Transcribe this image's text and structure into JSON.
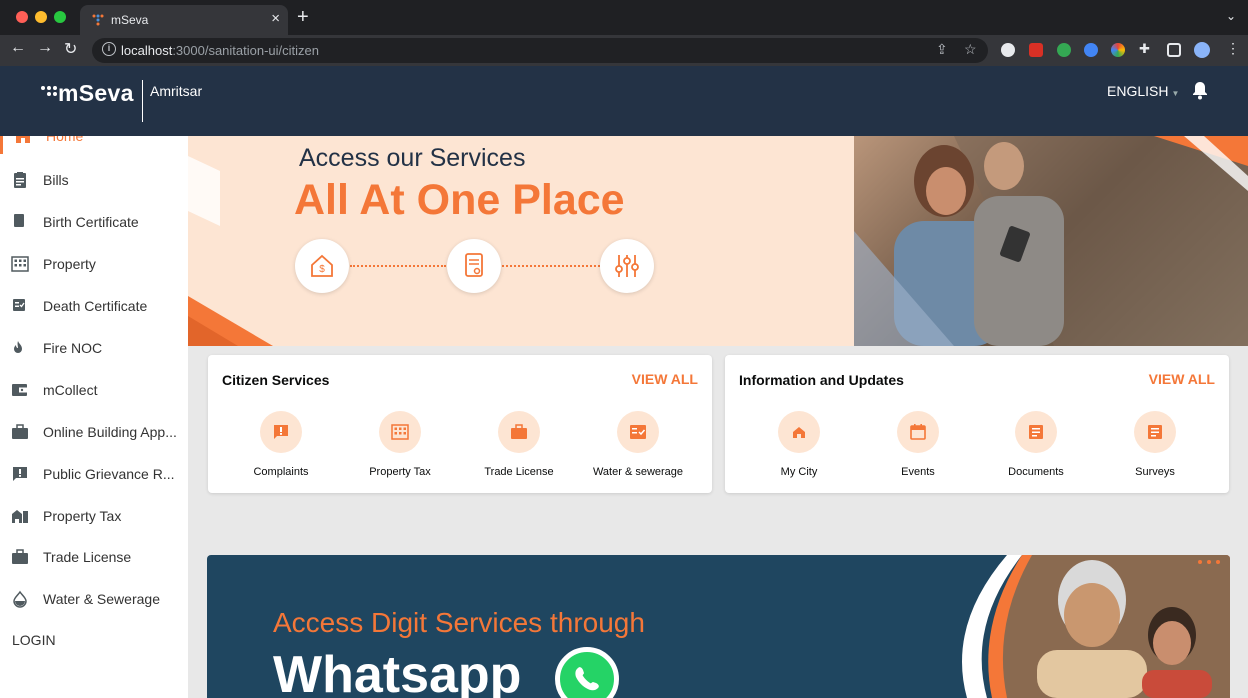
{
  "browser": {
    "tab_title": "mSeva",
    "url_host": "localhost",
    "url_path": ":3000/sanitation-ui/citizen"
  },
  "header": {
    "logo": "mSeva",
    "city": "Amritsar",
    "language": "ENGLISH"
  },
  "sidebar": {
    "items": [
      {
        "label": "Home",
        "icon": "home-icon"
      },
      {
        "label": "Bills",
        "icon": "bill-icon"
      },
      {
        "label": "Birth Certificate",
        "icon": "book-icon"
      },
      {
        "label": "Property",
        "icon": "building-icon"
      },
      {
        "label": "Death Certificate",
        "icon": "certificate-icon"
      },
      {
        "label": "Fire NOC",
        "icon": "fire-icon"
      },
      {
        "label": "mCollect",
        "icon": "wallet-icon"
      },
      {
        "label": "Online Building App...",
        "icon": "briefcase-icon"
      },
      {
        "label": "Public Grievance R...",
        "icon": "grievance-icon"
      },
      {
        "label": "Property Tax",
        "icon": "property-tax-icon"
      },
      {
        "label": "Trade License",
        "icon": "briefcase-icon"
      },
      {
        "label": "Water & Sewerage",
        "icon": "drop-icon"
      }
    ],
    "login": "LOGIN"
  },
  "banner": {
    "line1": "Access our Services",
    "line2": "All At One Place"
  },
  "citizen_services": {
    "title": "Citizen Services",
    "view_all": "VIEW ALL",
    "items": [
      {
        "label": "Complaints",
        "icon": "complaint-icon"
      },
      {
        "label": "Property Tax",
        "icon": "building-icon"
      },
      {
        "label": "Trade License",
        "icon": "briefcase-icon"
      },
      {
        "label": "Water & sewerage",
        "icon": "meter-icon"
      }
    ]
  },
  "info_updates": {
    "title": "Information and Updates",
    "view_all": "VIEW ALL",
    "items": [
      {
        "label": "My City",
        "icon": "home-icon"
      },
      {
        "label": "Events",
        "icon": "calendar-icon"
      },
      {
        "label": "Documents",
        "icon": "document-icon"
      },
      {
        "label": "Surveys",
        "icon": "survey-icon"
      }
    ]
  },
  "whatsapp_banner": {
    "line1": "Access Digit Services through",
    "line2": "Whatsapp"
  },
  "colors": {
    "accent": "#f47738",
    "header_bg": "#233246"
  }
}
